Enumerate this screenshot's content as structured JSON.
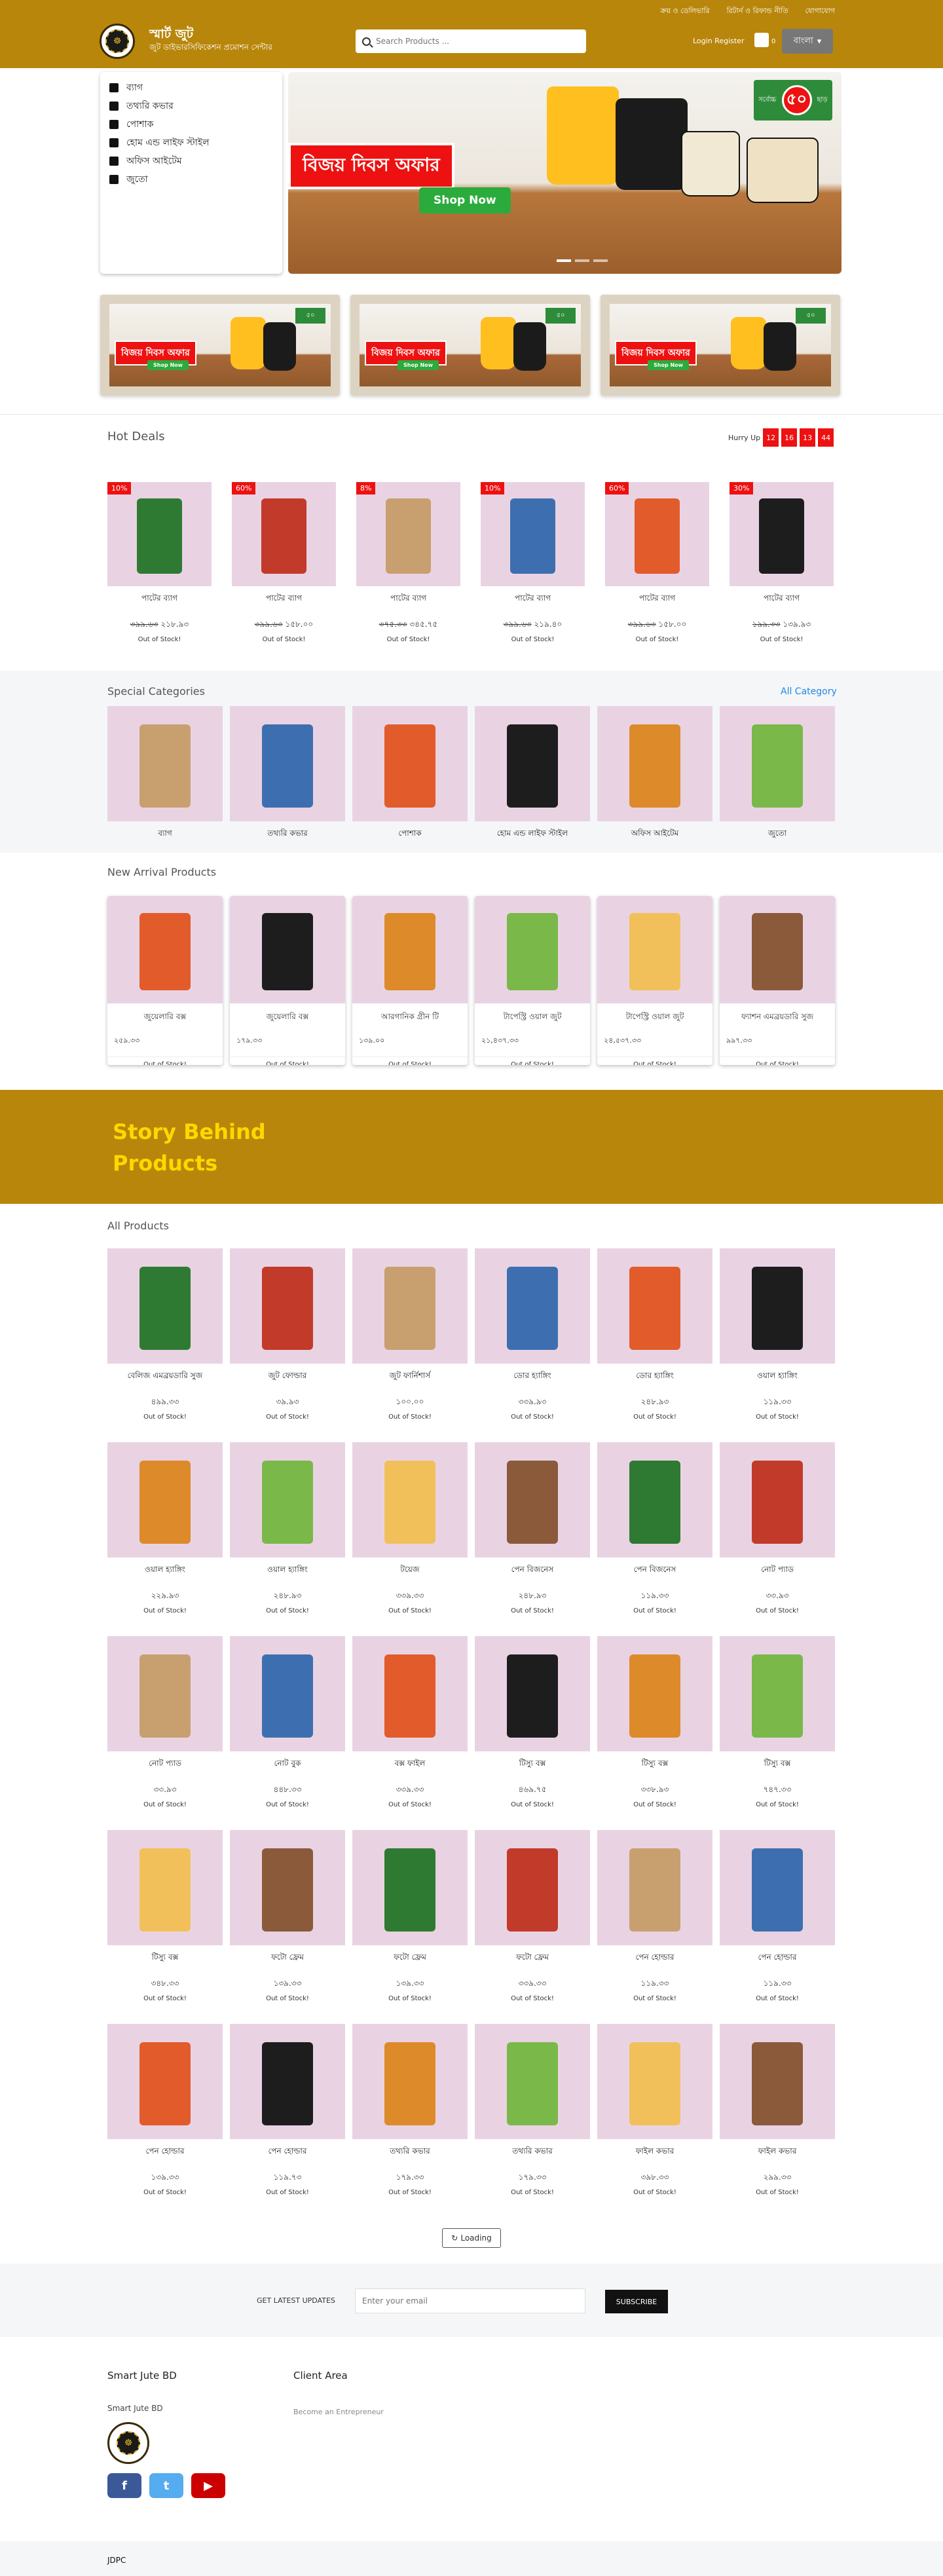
{
  "header": {
    "top_links": [
      "ক্রয় ও ডেলিভারি",
      "রিটার্ন ও রিফান্ড নীতি",
      "যোগাযোগ"
    ],
    "brand_title": "স্মার্ট জুট",
    "brand_sub": "জুট ডাইভারসিফিকেশন প্রমোশন সেন্টার",
    "search_placeholder": "Search Products ...",
    "login_text": "Login Register",
    "cart_count": "0",
    "language": "বাংলা"
  },
  "sidebar": {
    "items": [
      {
        "label": "ব্যাগ"
      },
      {
        "label": "তথ্যরি কভার"
      },
      {
        "label": "পোশাক"
      },
      {
        "label": "হোম এন্ড লাইফ স্টাইল"
      },
      {
        "label": "অফিস আইটেম"
      },
      {
        "label": "জুতো"
      }
    ]
  },
  "banner": {
    "headline": "বিজয় দিবস অফার",
    "button": "Shop Now",
    "discount_prefix": "সর্বোচ্চ",
    "discount_value": "৫০",
    "discount_suffix": "ছাড়"
  },
  "mini_banners": [
    {
      "headline": "বিজয় দিবস অফার",
      "button": "Shop Now",
      "discount": "৫০"
    },
    {
      "headline": "বিজয় দিবস অফার",
      "button": "Shop Now",
      "discount": "৫০"
    },
    {
      "headline": "বিজয় দিবস অফার",
      "button": "Shop Now",
      "discount": "৫০"
    }
  ],
  "hot_deals": {
    "title": "Hot Deals",
    "hurry_label": "Hurry Up",
    "timer": [
      "12",
      "16",
      "13",
      "44"
    ],
    "products": [
      {
        "name": "পাটের ব্যাগ",
        "old_price": "৩৯৯.৬৩",
        "price": "২১৮.৯৩",
        "discount": "10%",
        "stock": "Out of Stock!"
      },
      {
        "name": "পাটের ব্যাগ",
        "old_price": "৩৯৯.৬৩",
        "price": "১৫৮.০০",
        "discount": "60%",
        "stock": "Out of Stock!"
      },
      {
        "name": "পাটের ব্যাগ",
        "old_price": "৩৭৫.৩৩",
        "price": "৩৪৫.৭৫",
        "discount": "8%",
        "stock": "Out of Stock!"
      },
      {
        "name": "পাটের ব্যাগ",
        "old_price": "৩৯৯.৬৩",
        "price": "২১৯.৪০",
        "discount": "10%",
        "stock": "Out of Stock!"
      },
      {
        "name": "পাটের ব্যাগ",
        "old_price": "৩৯৯.৬৩",
        "price": "১৫৮.০০",
        "discount": "60%",
        "stock": "Out of Stock!"
      },
      {
        "name": "পাটের ব্যাগ",
        "old_price": "১৯৯.৩৩",
        "price": "১৩৯.৯৩",
        "discount": "30%",
        "stock": "Out of Stock!"
      }
    ]
  },
  "special_categories": {
    "title": "Special Categories",
    "all_link": "All Category",
    "items": [
      {
        "name": "ব্যাগ"
      },
      {
        "name": "তথ্যরি কভার"
      },
      {
        "name": "পোশাক"
      },
      {
        "name": "হোম এন্ড লাইফ স্টাইল"
      },
      {
        "name": "অফিস আইটেম"
      },
      {
        "name": "জুতো"
      }
    ]
  },
  "new_arrivals": {
    "title": "New Arrival Products",
    "products": [
      {
        "name": "জুয়েলারি বক্স",
        "price": "২৫৯.৩৩",
        "stock": "Out of Stock!"
      },
      {
        "name": "জুয়েলারি বক্স",
        "price": "১৭৯.৩৩",
        "stock": "Out of Stock!"
      },
      {
        "name": "আরগানিক গ্রীন টি",
        "price": "১৩৯.০০",
        "stock": "Out of Stock!"
      },
      {
        "name": "টাপেস্ট্রি ওয়াল জুট",
        "price": "২১,৪৩৭.৩৩",
        "stock": "Out of Stock!"
      },
      {
        "name": "টাপেস্ট্রি ওয়াল জুট",
        "price": "২৪,৫৩৭.৩৩",
        "stock": "Out of Stock!"
      },
      {
        "name": "ফ্যাশন এমব্রয়ডারি সুজ",
        "price": "৯৯৭.৩৩",
        "stock": "Out of Stock!"
      }
    ]
  },
  "story": {
    "line1": "Story Behind",
    "line2": "Products"
  },
  "all_products": {
    "title": "All Products",
    "rows": [
      [
        {
          "name": "বেলিজ এমব্রয়ডারি সুজ",
          "price": "৪৯৯.৩৩",
          "stock": "Out of Stock!"
        },
        {
          "name": "জুট ফোল্ডার",
          "price": "৩৯.৯৩",
          "stock": "Out of Stock!"
        },
        {
          "name": "জুট ফার্নিশার্স",
          "price": "১০০.০০",
          "stock": "Out of Stock!"
        },
        {
          "name": "ডোর হ্যাঙ্গিং",
          "price": "৩৩৯.৯৩",
          "stock": "Out of Stock!"
        },
        {
          "name": "ডোর হ্যাঙ্গিং",
          "price": "২৪৮.৯৩",
          "stock": "Out of Stock!"
        },
        {
          "name": "ওয়াল হ্যাঙ্গিং",
          "price": "১১৯.৩৩",
          "stock": "Out of Stock!"
        }
      ],
      [
        {
          "name": "ওয়াল হ্যাঙ্গিং",
          "price": "২২৯.৯৩",
          "stock": "Out of Stock!"
        },
        {
          "name": "ওয়াল হ্যাঙ্গিং",
          "price": "২৪৮.৯৩",
          "stock": "Out of Stock!"
        },
        {
          "name": "টয়েজ",
          "price": "৩৩৯.৩৩",
          "stock": "Out of Stock!"
        },
        {
          "name": "পেন বিজনেস",
          "price": "২৪৮.৯৩",
          "stock": "Out of Stock!"
        },
        {
          "name": "পেন বিজনেস",
          "price": "১১৯.৩৩",
          "stock": "Out of Stock!"
        },
        {
          "name": "নোট প্যাড",
          "price": "৩৩.৯৩",
          "stock": "Out of Stock!"
        }
      ],
      [
        {
          "name": "নোট প্যাড",
          "price": "৩৩.৯৩",
          "stock": "Out of Stock!"
        },
        {
          "name": "নোট বুক",
          "price": "৪৪৮.৩৩",
          "stock": "Out of Stock!"
        },
        {
          "name": "বক্স ফাইল",
          "price": "৩৩৯.৩৩",
          "stock": "Out of Stock!"
        },
        {
          "name": "টিস্যু বক্স",
          "price": "৪৬৯.৭৫",
          "stock": "Out of Stock!"
        },
        {
          "name": "টিস্যু বক্স",
          "price": "৩৩৮.৯৩",
          "stock": "Out of Stock!"
        },
        {
          "name": "টিস্যু বক্স",
          "price": "৭৪৭.৩৩",
          "stock": "Out of Stock!"
        }
      ],
      [
        {
          "name": "টিস্যু বক্স",
          "price": "৩৪৮.৩৩",
          "stock": "Out of Stock!"
        },
        {
          "name": "ফটো ফ্রেম",
          "price": "১৩৯.৩৩",
          "stock": "Out of Stock!"
        },
        {
          "name": "ফটো ফ্রেম",
          "price": "১৩৯.৩৩",
          "stock": "Out of Stock!"
        },
        {
          "name": "ফটো ফ্রেম",
          "price": "৩৩৯.৩৩",
          "stock": "Out of Stock!"
        },
        {
          "name": "পেন হোল্ডার",
          "price": "১১৯.৩৩",
          "stock": "Out of Stock!"
        },
        {
          "name": "পেন হোল্ডার",
          "price": "১১৯.৩৩",
          "stock": "Out of Stock!"
        }
      ],
      [
        {
          "name": "পেন হোল্ডার",
          "price": "১৩৯.৩৩",
          "stock": "Out of Stock!"
        },
        {
          "name": "পেন হোল্ডার",
          "price": "১১৯.৭৩",
          "stock": "Out of Stock!"
        },
        {
          "name": "তথ্যরি কভার",
          "price": "১৭৯.৩৩",
          "stock": "Out of Stock!"
        },
        {
          "name": "তথ্যরি কভার",
          "price": "১৭৯.৩৩",
          "stock": "Out of Stock!"
        },
        {
          "name": "ফাইল কভার",
          "price": "৩৯৮.৩৩",
          "stock": "Out of Stock!"
        },
        {
          "name": "ফাইল কভার",
          "price": "২৯৯.৩৩",
          "stock": "Out of Stock!"
        }
      ]
    ]
  },
  "loading_label": "Loading",
  "newsletter": {
    "label": "GET LATEST UPDATES",
    "placeholder": "Enter your email",
    "button": "SUBSCRIBE"
  },
  "footer": {
    "col1_title": "Smart Jute BD",
    "col1_sub": "Smart Jute BD",
    "col2_title": "Client Area",
    "col2_link": "Become an Entrepreneur",
    "social": [
      "facebook-icon",
      "twitter-icon",
      "youtube-icon"
    ],
    "bottom": "JDPC"
  },
  "colors": {
    "brand": "#b8860b",
    "accent_red": "#ee1111",
    "button_green": "#2bab3b",
    "link_blue": "#1e88e5",
    "product_bg": "#e9d3e3"
  }
}
